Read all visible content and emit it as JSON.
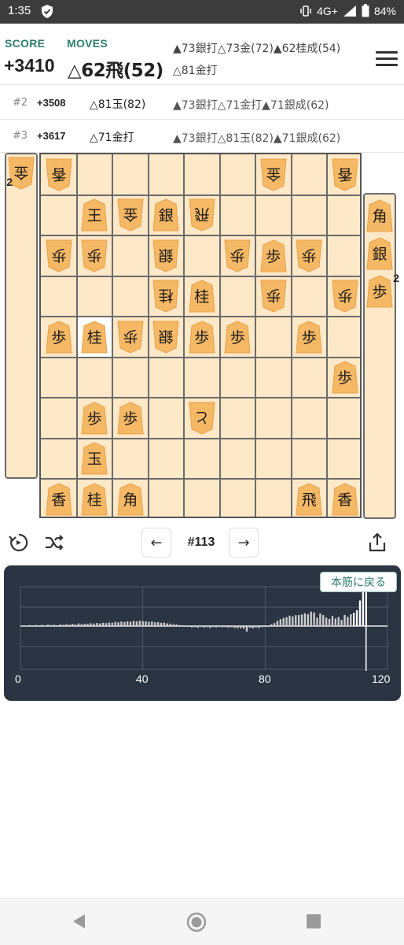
{
  "status": {
    "time": "1:35",
    "network": "4G+",
    "battery": "84%"
  },
  "header": {
    "score_label": "SCORE",
    "moves_label": "MOVES",
    "score": "+3410",
    "move": "△62飛(52)",
    "pv_line1": "▲73銀打△73金(72)▲62桂成(54)",
    "pv_line2": "△81金打"
  },
  "alternatives": [
    {
      "num": "#2",
      "score": "+3508",
      "move": "△81玉(82)",
      "pv": "▲73銀打△71金打▲71銀成(62)"
    },
    {
      "num": "#3",
      "score": "+3617",
      "move": "△71金打",
      "pv": "▲73銀打△81玉(82)▲71銀成(62)"
    }
  ],
  "board": {
    "gote_hand": [
      {
        "piece": "金",
        "count": "2"
      }
    ],
    "sente_hand": [
      {
        "piece": "角",
        "count": ""
      },
      {
        "piece": "銀",
        "count": ""
      },
      {
        "piece": "歩",
        "count": "2"
      }
    ],
    "pieces": [
      {
        "row": 0,
        "col": 0,
        "piece": "香",
        "side": "gote"
      },
      {
        "row": 0,
        "col": 6,
        "piece": "金",
        "side": "gote"
      },
      {
        "row": 0,
        "col": 8,
        "piece": "香",
        "side": "gote"
      },
      {
        "row": 1,
        "col": 1,
        "piece": "王",
        "side": "sente"
      },
      {
        "row": 1,
        "col": 2,
        "piece": "金",
        "side": "gote"
      },
      {
        "row": 1,
        "col": 3,
        "piece": "銀",
        "side": "sente"
      },
      {
        "row": 1,
        "col": 4,
        "piece": "飛",
        "side": "gote"
      },
      {
        "row": 2,
        "col": 0,
        "piece": "歩",
        "side": "gote"
      },
      {
        "row": 2,
        "col": 1,
        "piece": "歩",
        "side": "gote"
      },
      {
        "row": 2,
        "col": 3,
        "piece": "銀",
        "side": "gote"
      },
      {
        "row": 2,
        "col": 5,
        "piece": "歩",
        "side": "gote"
      },
      {
        "row": 2,
        "col": 6,
        "piece": "歩",
        "side": "sente"
      },
      {
        "row": 2,
        "col": 7,
        "piece": "歩",
        "side": "gote"
      },
      {
        "row": 3,
        "col": 3,
        "piece": "桂",
        "side": "gote"
      },
      {
        "row": 3,
        "col": 4,
        "piece": "桂",
        "side": "sente"
      },
      {
        "row": 3,
        "col": 6,
        "piece": "歩",
        "side": "gote"
      },
      {
        "row": 3,
        "col": 8,
        "piece": "歩",
        "side": "gote"
      },
      {
        "row": 4,
        "col": 0,
        "piece": "歩",
        "side": "sente"
      },
      {
        "row": 4,
        "col": 1,
        "piece": "桂",
        "side": "sente"
      },
      {
        "row": 4,
        "col": 2,
        "piece": "歩",
        "side": "gote"
      },
      {
        "row": 4,
        "col": 3,
        "piece": "銀",
        "side": "gote"
      },
      {
        "row": 4,
        "col": 4,
        "piece": "歩",
        "side": "sente"
      },
      {
        "row": 4,
        "col": 5,
        "piece": "歩",
        "side": "sente"
      },
      {
        "row": 4,
        "col": 7,
        "piece": "歩",
        "side": "sente"
      },
      {
        "row": 5,
        "col": 8,
        "piece": "歩",
        "side": "sente"
      },
      {
        "row": 6,
        "col": 1,
        "piece": "歩",
        "side": "sente"
      },
      {
        "row": 6,
        "col": 2,
        "piece": "歩",
        "side": "sente"
      },
      {
        "row": 6,
        "col": 4,
        "piece": "と",
        "side": "gote"
      },
      {
        "row": 7,
        "col": 1,
        "piece": "玉",
        "side": "sente"
      },
      {
        "row": 8,
        "col": 0,
        "piece": "香",
        "side": "sente"
      },
      {
        "row": 8,
        "col": 1,
        "piece": "桂",
        "side": "sente"
      },
      {
        "row": 8,
        "col": 2,
        "piece": "角",
        "side": "sente"
      },
      {
        "row": 8,
        "col": 7,
        "piece": "飛",
        "side": "sente"
      },
      {
        "row": 8,
        "col": 8,
        "piece": "香",
        "side": "sente"
      }
    ],
    "highlight": {
      "row": 4,
      "col": 1
    }
  },
  "controls": {
    "prev_label": "←",
    "next_label": "→",
    "move_number": "#113",
    "icons": [
      "flip-board-icon",
      "shuffle-icon",
      "share-icon"
    ]
  },
  "chart": {
    "return_label": "本筋に戻る",
    "x_ticks": [
      "0",
      "40",
      "80",
      "120"
    ],
    "colors": {
      "background": "#2b3442",
      "bar": "#d0d0d0",
      "accent": "#2e7d6b"
    }
  },
  "chart_data": {
    "type": "bar",
    "xlim": [
      0,
      120
    ],
    "ylim": [
      -4000,
      4000
    ],
    "current_move": 113,
    "x": [
      1,
      2,
      3,
      4,
      5,
      6,
      7,
      8,
      9,
      10,
      11,
      12,
      13,
      14,
      15,
      16,
      17,
      18,
      19,
      20,
      21,
      22,
      23,
      24,
      25,
      26,
      27,
      28,
      29,
      30,
      31,
      32,
      33,
      34,
      35,
      36,
      37,
      38,
      39,
      40,
      41,
      42,
      43,
      44,
      45,
      46,
      47,
      48,
      49,
      50,
      51,
      52,
      53,
      54,
      55,
      56,
      57,
      58,
      59,
      60,
      61,
      62,
      63,
      64,
      65,
      66,
      67,
      68,
      69,
      70,
      71,
      72,
      73,
      74,
      75,
      76,
      77,
      78,
      79,
      80,
      81,
      82,
      83,
      84,
      85,
      86,
      87,
      88,
      89,
      90,
      91,
      92,
      93,
      94,
      95,
      96,
      97,
      98,
      99,
      100,
      101,
      102,
      103,
      104,
      105,
      106,
      107,
      108,
      109,
      110,
      111,
      112,
      113
    ],
    "values": [
      50,
      40,
      90,
      30,
      110,
      70,
      120,
      60,
      150,
      100,
      130,
      80,
      170,
      120,
      190,
      140,
      220,
      160,
      260,
      190,
      240,
      220,
      280,
      250,
      310,
      270,
      330,
      300,
      360,
      340,
      420,
      380,
      450,
      410,
      480,
      440,
      520,
      470,
      540,
      500,
      480,
      430,
      460,
      380,
      400,
      330,
      350,
      270,
      250,
      180,
      160,
      100,
      80,
      -50,
      -80,
      -140,
      -110,
      -170,
      -90,
      -150,
      -120,
      -180,
      -100,
      -140,
      -90,
      -130,
      -110,
      -160,
      -120,
      -190,
      -230,
      -220,
      -260,
      -550,
      -170,
      -240,
      -150,
      -200,
      -100,
      -60,
      0,
      170,
      300,
      520,
      700,
      820,
      900,
      1060,
      980,
      1100,
      1120,
      1180,
      1300,
      1200,
      1460,
      1380,
      850,
      1280,
      1120,
      850,
      720,
      1010,
      760,
      920,
      630,
      1130,
      930,
      1200,
      1350,
      1600,
      2600,
      3500,
      3410
    ]
  }
}
